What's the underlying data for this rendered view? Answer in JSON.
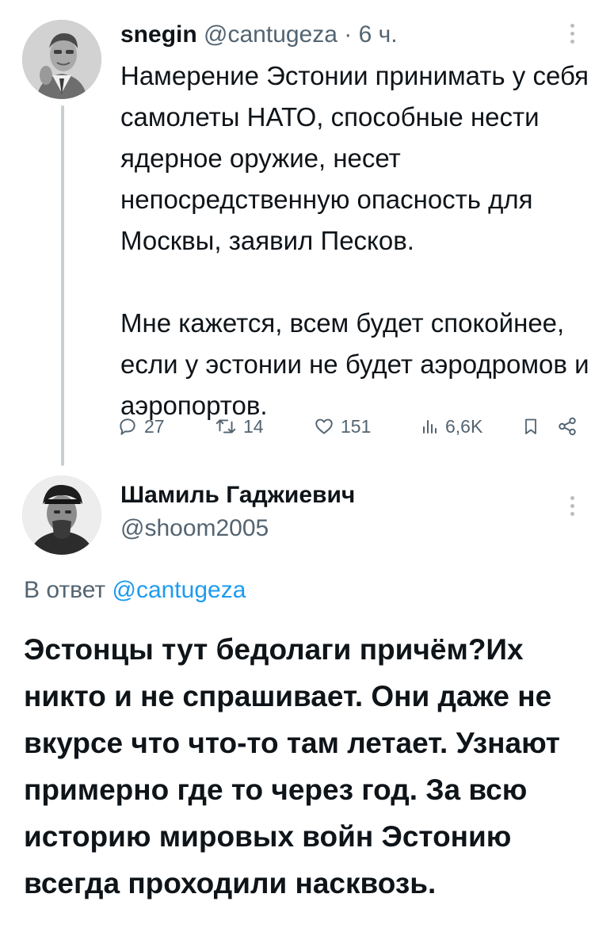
{
  "tweet": {
    "author_name": "snegin",
    "author_handle": "@cantugeza",
    "separator": "·",
    "time": "6 ч.",
    "text_paragraphs": [
      "Намерение Эстонии принимать у себя самолеты НАТО, способные нести ядерное оружие, несет непосредственную опасность для Москвы, заявил Песков.",
      "Мне кажется, всем будет спокойнее, если у эстонии не будет аэродромов и аэропортов."
    ],
    "stats": {
      "replies": "27",
      "reposts": "14",
      "likes": "151",
      "views": "6,6K"
    }
  },
  "reply": {
    "author_name": "Шамиль Гаджиевич",
    "author_handle": "@shoom2005",
    "reply_to_label": "В ответ",
    "reply_to_handle": "@cantugeza",
    "text": "Эстонцы тут бедолаги причём?Их никто и не спрашивает. Они даже не вкурсе что что-то там летает. Узнают примерно где то через год. За всю историю мировых войн Эстонию всегда проходили насквозь."
  },
  "icons": [
    "reply-icon",
    "repost-icon",
    "like-icon",
    "views-icon",
    "bookmark-icon",
    "share-icon",
    "more-icon"
  ],
  "colors": {
    "text": "#0f1419",
    "secondary": "#536471",
    "mention": "#1d9bf0",
    "thread_line": "#c9ced2"
  }
}
